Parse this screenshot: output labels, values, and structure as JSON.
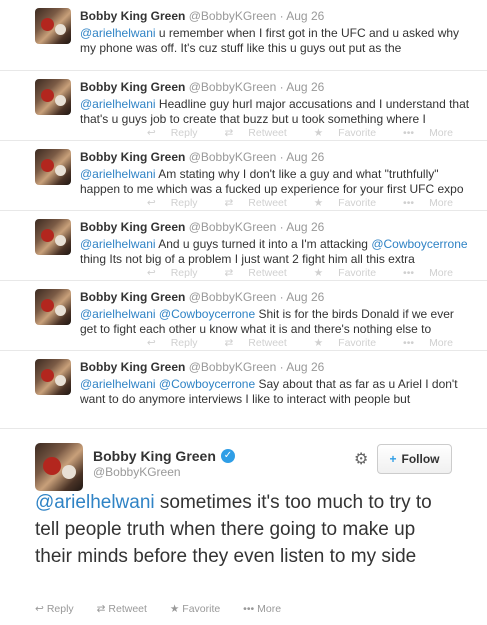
{
  "tweets": [
    {
      "name": "Bobby King Green",
      "meta": "@BobbyKGreen · Aug 26",
      "mention": "",
      "text": "@arielhelwani u remember when I first got in the UFC and u asked why my phone was off. It's cuz stuff like this u guys out put as the",
      "mention1": "@arielhelwani",
      "rest": " u remember when I first got in the UFC and u asked why my phone was off. It's cuz stuff like this u guys out put as the"
    },
    {
      "name": "Bobby King Green",
      "meta": "@BobbyKGreen · Aug 26",
      "mention1": "@arielhelwani",
      "rest": " Headline guy hurl major accusations and I understand that that's u guys job to create that buzz but u took something where I"
    },
    {
      "name": "Bobby King Green",
      "meta": "@BobbyKGreen · Aug 26",
      "mention1": "@arielhelwani",
      "rest": " Am stating why I don't like a guy and what \"truthfully\" happen to me which was a fucked up experience for your first UFC expo"
    },
    {
      "name": "Bobby King Green",
      "meta": "@BobbyKGreen · Aug 26",
      "mention1": "@arielhelwani",
      "rest": " And u guys turned it into a I'm attacking ",
      "mention2": "@Cowboycerrone",
      "rest2": " thing Its not big of a problem I just want 2 fight him all this extra"
    },
    {
      "name": "Bobby King Green",
      "meta": "@BobbyKGreen · Aug 26",
      "mention1": "@arielhelwani",
      "rest": " ",
      "mention2": "@Cowboycerrone",
      "rest2": " Shit is for the birds Donald if we ever get to fight each other u know what it is and there's nothing else to"
    },
    {
      "name": "Bobby King Green",
      "meta": "@BobbyKGreen · Aug 26",
      "mention1": "@arielhelwani",
      "rest": " ",
      "mention2": "@Cowboycerrone",
      "rest2": " Say about that as far as u Ariel I don't want to do anymore interviews I like to interact with people but"
    }
  ],
  "actions": {
    "reply": "Reply",
    "retweet": "Retweet",
    "favorite": "Favorite",
    "more": "More"
  },
  "expanded": {
    "name": "Bobby King Green",
    "handle": "@BobbyKGreen",
    "follow_label": "Follow",
    "mention": "@arielhelwani",
    "text": " sometimes it's too much to try to tell people truth when there going to make up their minds before they even listen to my side"
  },
  "icons": {
    "reply": "↩",
    "retweet": "⇄",
    "favorite": "★",
    "more": "•••",
    "gear": "⚙",
    "verified": "✓",
    "follow_plus": "+"
  },
  "colors": {
    "mention": "#2f83c5",
    "verified": "#2f9ee6"
  }
}
